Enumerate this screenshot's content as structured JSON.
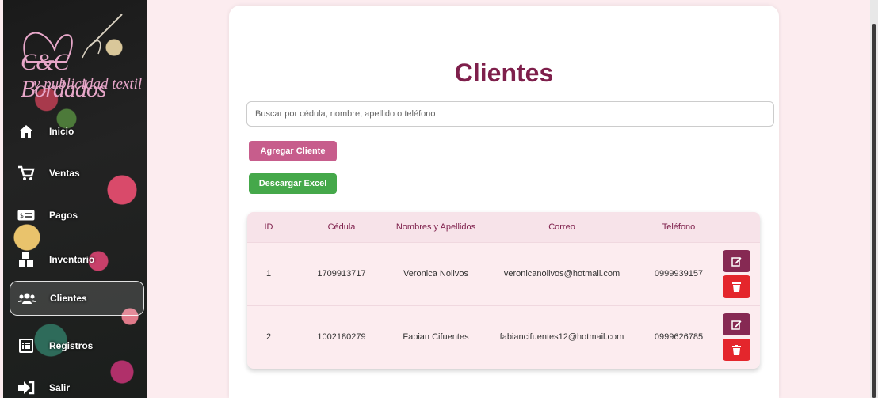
{
  "brand": {
    "name": "C&C Bordados",
    "tagline": "y publicidad textil"
  },
  "sidebar": {
    "items": [
      {
        "label": "Inicio",
        "icon": "home-icon"
      },
      {
        "label": "Ventas",
        "icon": "cart-icon"
      },
      {
        "label": "Pagos",
        "icon": "money-icon"
      },
      {
        "label": "Inventario",
        "icon": "boxes-icon"
      },
      {
        "label": "Clientes",
        "icon": "users-icon",
        "active": true
      },
      {
        "label": "Registros",
        "icon": "list-icon"
      },
      {
        "label": "Salir",
        "icon": "logout-icon"
      }
    ]
  },
  "main": {
    "title": "Clientes",
    "search": {
      "placeholder": "Buscar por cédula, nombre, apellido o teléfono",
      "value": ""
    },
    "buttons": {
      "add": "Agregar Cliente",
      "excel": "Descargar Excel"
    },
    "table": {
      "headers": [
        "ID",
        "Cédula",
        "Nombres y Apellidos",
        "Correo",
        "Teléfono",
        ""
      ],
      "rows": [
        {
          "id": "1",
          "cedula": "1709913717",
          "nombre": "Veronica Nolivos",
          "correo": "veronicanolivos@hotmail.com",
          "telefono": "0999939157"
        },
        {
          "id": "2",
          "cedula": "1002180279",
          "nombre": "Fabian Cifuentes",
          "correo": "fabiancifuentes12@hotmail.com",
          "telefono": "0999626785"
        }
      ]
    }
  },
  "colors": {
    "accent": "#7e1f4b",
    "add": "#c75d8c",
    "excel": "#45a84a",
    "edit": "#862953",
    "delete": "#e4262c",
    "background": "#fcecef"
  }
}
